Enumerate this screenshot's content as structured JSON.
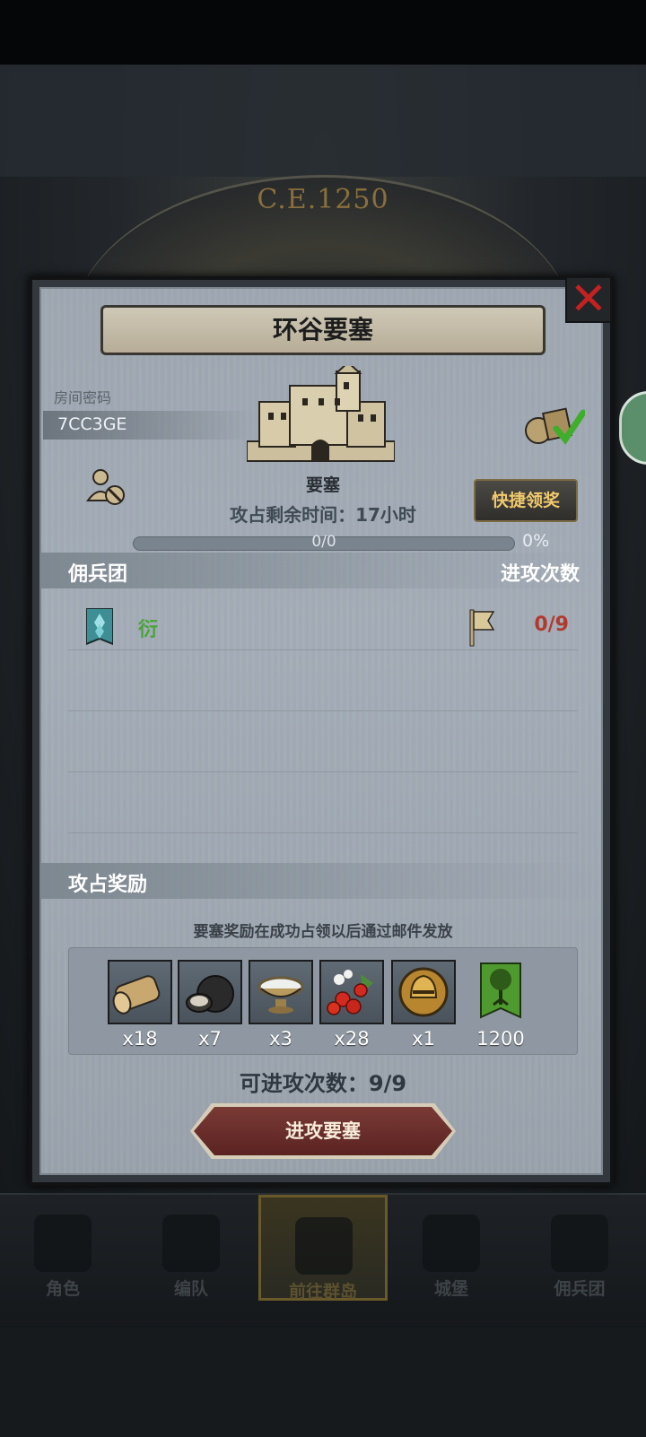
{
  "background": {
    "era_label": "C.E.1250"
  },
  "dialog": {
    "title": "环谷要塞",
    "close_icon": "close-x-icon",
    "room_label": "房间密码",
    "room_code": "7CC3GE",
    "castle_label": "要塞",
    "quick_claim_label": "快捷领奖",
    "remaining_time": "攻占剩余时间：17小时",
    "progress_text": "0/0",
    "progress_percent": "0%",
    "progress_value": 0,
    "mercenary_header": "佣兵团",
    "attack_count_header": "进攻次数",
    "mercenary_rows": [
      {
        "name": "衍",
        "attack_count": "0/9"
      }
    ],
    "rewards_header": "攻占奖励",
    "rewards_note": "要塞奖励在成功占领以后通过邮件发放",
    "rewards": [
      {
        "icon": "wood-log-icon",
        "qty": "x18"
      },
      {
        "icon": "truffle-icon",
        "qty": "x7"
      },
      {
        "icon": "salt-bowl-icon",
        "qty": "x3"
      },
      {
        "icon": "berries-icon",
        "qty": "x28"
      },
      {
        "icon": "knight-helmet-icon",
        "qty": "x1"
      },
      {
        "icon": "tree-banner-icon",
        "qty": "1200"
      }
    ],
    "attacks_available": "可进攻次数：9/9",
    "attack_button": "进攻要塞"
  },
  "bottom_nav": {
    "items": [
      {
        "label": "角色",
        "icon": "character-icon"
      },
      {
        "label": "编队",
        "icon": "formation-icon"
      },
      {
        "label": "前往群岛",
        "icon": "islands-compass-icon",
        "active": true
      },
      {
        "label": "城堡",
        "icon": "castle-icon"
      },
      {
        "label": "佣兵团",
        "icon": "mercenary-icon"
      }
    ]
  },
  "colors": {
    "attack_count_red": "#b03a2e",
    "mercenary_green": "#4aa43b",
    "quick_claim_gold": "#f0c96d",
    "close_red": "#c52121"
  }
}
